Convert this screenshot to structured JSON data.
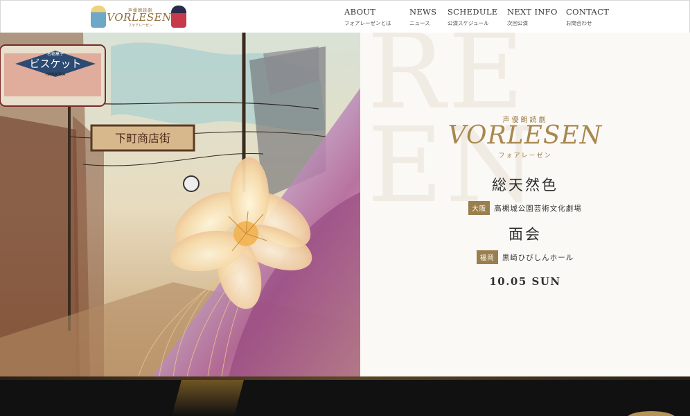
{
  "header": {
    "logo": {
      "series": "声優朗読劇",
      "word": "VORLESEN",
      "kana": "フォアレーゼン"
    },
    "nav": [
      {
        "en": "ABOUT",
        "jp": "フォアレーゼンとは"
      },
      {
        "en": "NEWS",
        "jp": "ニュース"
      },
      {
        "en": "SCHEDULE",
        "jp": "公演スケジュール"
      },
      {
        "en": "NEXT INFO",
        "jp": "次回公演"
      },
      {
        "en": "CONTACT",
        "jp": "お問合わせ"
      }
    ]
  },
  "artwork": {
    "sign_shop": "ビスケット",
    "sign_shop_sub": "HANASKA",
    "sign_shop_top": "名物菓子",
    "sign_street": "下町商店街"
  },
  "hero": {
    "series": "声優朗読劇",
    "brand": "VORLESEN",
    "brand_kana": "フォアレーゼン",
    "watermark": "RE\nEN",
    "performances": [
      {
        "title": "総天然色",
        "city": "大阪",
        "venue": "高槻城公園芸術文化劇場"
      },
      {
        "title": "面会",
        "city": "福岡",
        "venue": "黒崎ひびしんホール"
      }
    ],
    "date": "10.05 SUN"
  }
}
